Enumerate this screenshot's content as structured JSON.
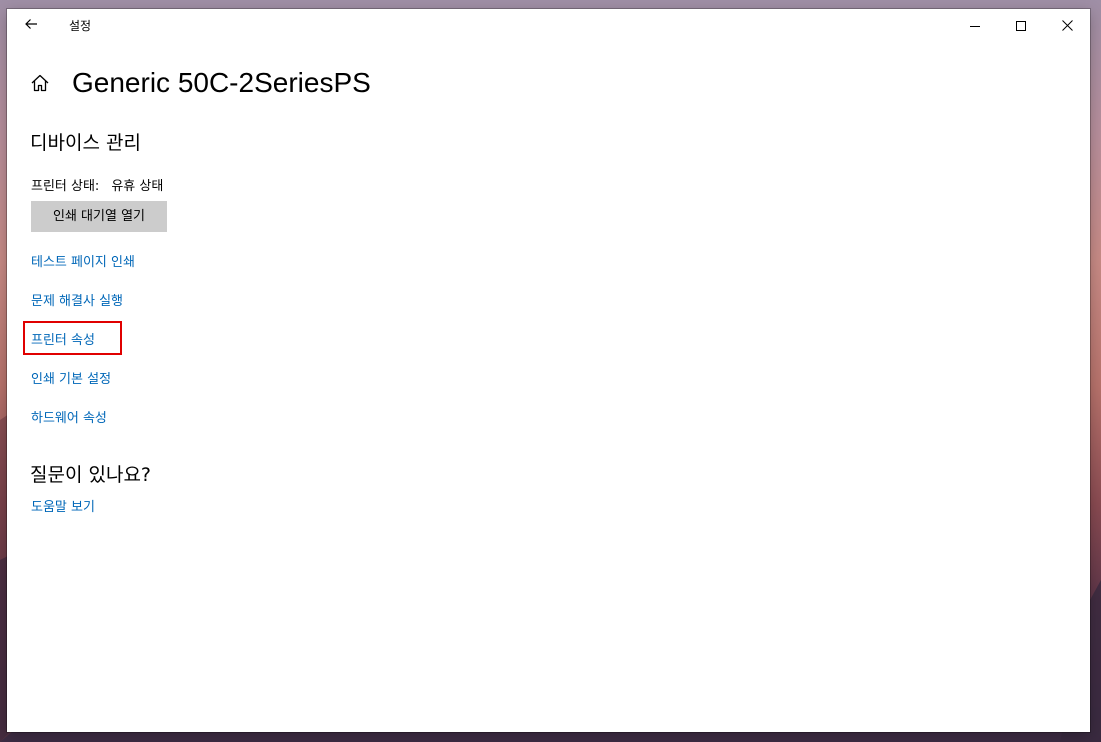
{
  "window": {
    "app_title": "설정",
    "icons": {
      "back": "back-arrow-icon",
      "minimize": "minimize-icon",
      "maximize": "maximize-icon",
      "close": "close-icon",
      "home": "home-icon"
    }
  },
  "header": {
    "title": "Generic 50C-2SeriesPS"
  },
  "device_management": {
    "section_title": "디바이스 관리",
    "status_label": "프린터 상태:",
    "status_value": "유휴 상태",
    "open_queue_button": "인쇄 대기열 열기",
    "links": {
      "test_page": "테스트 페이지 인쇄",
      "troubleshooter": "문제 해결사 실행",
      "printer_properties": "프린터 속성",
      "printing_preferences": "인쇄 기본 설정",
      "hardware_properties": "하드웨어 속성"
    }
  },
  "help_section": {
    "section_title": "질문이 있나요?",
    "help_link": "도움말 보기"
  },
  "colors": {
    "link": "#0067b8",
    "button_bg": "#cccccc",
    "highlight": "#e00000"
  }
}
